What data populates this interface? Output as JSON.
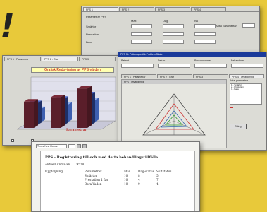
{
  "background": {
    "lines": [
      "",
      "",
      "",
      "",
      "",
      "",
      "",
      "",
      "",
      "",
      "",
      "",
      ""
    ],
    "exclaim": "!"
  },
  "win1": {
    "tabs": [
      "PPS 1",
      "PPS 2",
      "PPS 3",
      "PPS 4"
    ],
    "title": "Parametrar PPS",
    "col_headers": [
      "Max",
      "Dag",
      "Nu"
    ],
    "rows": [
      "Smärtor",
      "Prestation",
      "Bara"
    ],
    "side_label": "Antal parametrar"
  },
  "win2": {
    "tabs": [
      "PPS 1 - Parametrar",
      "PPS 2 - Graf",
      "PPS 3"
    ],
    "graph_title": "Grafisk Redovisning av PPS-värden",
    "axis_label": "Parametrar",
    "checkbox_labels": [
      "",
      ""
    ],
    "chart_values": [
      [
        6,
        5,
        3
      ],
      [
        7,
        6,
        4
      ],
      [
        9,
        7,
        5
      ]
    ]
  },
  "win3": {
    "title_bar": "PPS 5 - Patientspecifik Problem Skala",
    "fields": [
      "Patient",
      "Datum",
      "Personnummer",
      "Behandlare"
    ],
    "tabs": [
      "PPS 1 - Parametrar",
      "PPS 2 - Graf",
      "PPS 3",
      "PPS 4 - Utvärdering"
    ],
    "panel_title": "PPS - Utvärdering",
    "list_header": "Antal parametrar",
    "list_items": [
      "1 - Smärtor",
      "2 - Prestation",
      "3 - Bara",
      "",
      "",
      "",
      "",
      "",
      "",
      ""
    ],
    "legend": [
      "",
      "",
      ""
    ],
    "button": "Stäng"
  },
  "win4": {
    "toolbar_dropdown": "Times New Roman",
    "heading": "PPS - Registrering till och med detta behandlingstillfälle",
    "year_label": "Aktuell Anmälan",
    "year_value": "9528",
    "cols": [
      "Uppföljning",
      "Parametrar",
      "Max",
      "Dag-status",
      "Slutstatus"
    ],
    "rows": [
      [
        "",
        "Smärtor",
        "10",
        "8",
        "5"
      ],
      [
        "",
        "Prestation 1 fas",
        "10",
        "4",
        "7"
      ],
      [
        "",
        "Bara Vaden",
        "10",
        "9",
        "4"
      ]
    ]
  }
}
